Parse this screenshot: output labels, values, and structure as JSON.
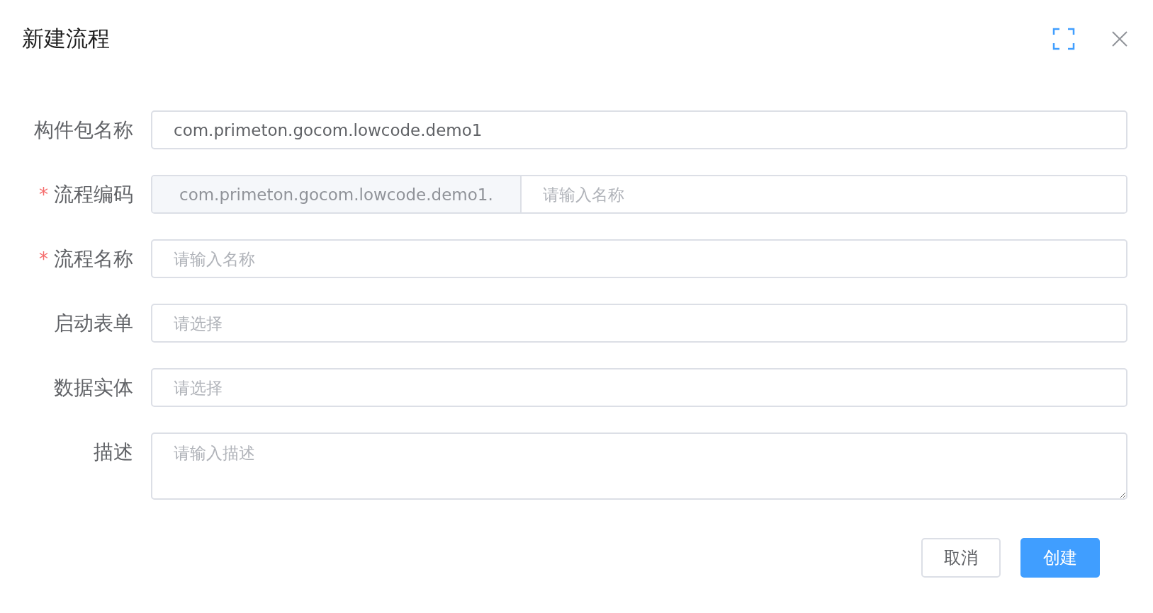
{
  "dialog": {
    "title": "新建流程"
  },
  "fields": [
    {
      "kind": "input",
      "label": "构件包名称",
      "required": false,
      "value": "com.primeton.gocom.lowcode.demo1"
    },
    {
      "kind": "prefixed",
      "label": "流程编码",
      "required": true,
      "prefix": "com.primeton.gocom.lowcode.demo1.",
      "placeholder": "请输入名称"
    },
    {
      "kind": "input",
      "label": "流程名称",
      "required": true,
      "placeholder": "请输入名称"
    },
    {
      "kind": "input",
      "label": "启动表单",
      "required": false,
      "placeholder": "请选择"
    },
    {
      "kind": "input",
      "label": "数据实体",
      "required": false,
      "placeholder": "请选择"
    },
    {
      "kind": "textarea",
      "label": "描述",
      "required": false,
      "placeholder": "请输入描述"
    }
  ],
  "required_mark": "*",
  "buttons": [
    {
      "label": "取消",
      "kind": "default"
    },
    {
      "label": "创建",
      "kind": "primary"
    }
  ]
}
